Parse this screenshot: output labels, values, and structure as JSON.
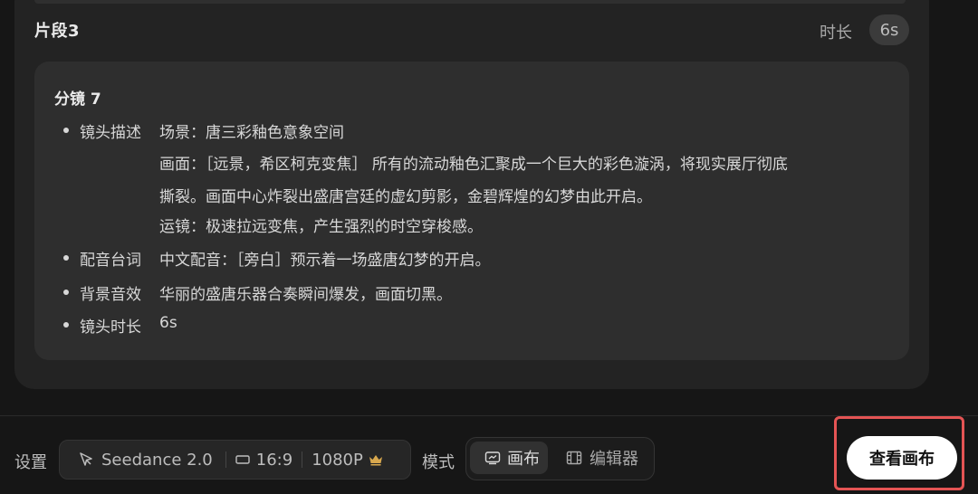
{
  "segment": {
    "title": "片段3",
    "duration_label": "时长",
    "duration_value": "6s"
  },
  "shot": {
    "title": "分镜 7",
    "rows": [
      {
        "label": "镜头描述",
        "lines": [
          "场景：唐三彩釉色意象空间",
          "画面：［远景，希区柯克变焦］ 所有的流动釉色汇聚成一个巨大的彩色漩涡，将现实展厅彻底",
          "撕裂。画面中心炸裂出盛唐宫廷的虚幻剪影，金碧辉煌的幻梦由此开启。",
          "运镜：极速拉远变焦，产生强烈的时空穿梭感。"
        ]
      },
      {
        "label": "配音台词",
        "lines": [
          "中文配音：［旁白］预示着一场盛唐幻梦的开启。"
        ]
      },
      {
        "label": "背景音效",
        "lines": [
          "华丽的盛唐乐器合奏瞬间爆发，画面切黑。"
        ]
      },
      {
        "label": "镜头时长",
        "lines": [
          "6s"
        ]
      }
    ]
  },
  "toolbar": {
    "settings_label": "设置",
    "model": "Seedance 2.0",
    "ratio": "16:9",
    "resolution": "1080P",
    "mode_label": "模式",
    "modes": [
      "画布",
      "编辑器"
    ],
    "active_mode": "画布",
    "view_canvas_button": "查看画布"
  },
  "colors": {
    "background": "#161616",
    "card": "#232323",
    "panel": "#2e2e2e",
    "highlight": "#e45454",
    "crown": "#d8a84e",
    "primary_button": "#ffffff"
  },
  "icons": {
    "model": "cursor-arrow-icon",
    "ratio": "aspect-ratio-icon",
    "resolution": "crown-icon",
    "canvas_mode": "canvas-icon",
    "editor_mode": "film-icon"
  }
}
